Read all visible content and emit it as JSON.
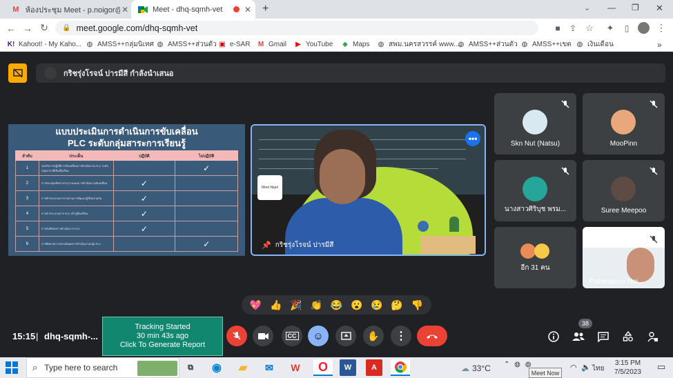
{
  "browser": {
    "tabs": [
      {
        "title": "ห้องประชุม Meet - p.noigor@gma",
        "icon": "gmail-icon"
      },
      {
        "title": "Meet - dhq-sqmh-vet",
        "icon": "meet-icon",
        "active": true
      }
    ],
    "new_tab": "+",
    "url": "meet.google.com/dhq-sqmh-vet",
    "bookmarks": [
      "Kahoot! - My Kaho...",
      "AMSS++กลุ่มนิเทศ",
      "AMSS++ส่วนตัว",
      "e-SAR",
      "Gmail",
      "YouTube",
      "Maps",
      "สพม.นครสวรรค์ www....",
      "AMSS++ส่วนตัว",
      "AMSS++เขต",
      "เงินเดือน"
    ]
  },
  "meet": {
    "presenter_text": "กริชรุ่งโรจน์ ปารมีสี กำลังนำเสนอ",
    "slide": {
      "title_line1": "แบบประเมินการดำเนินการขับเคลื่อน",
      "title_line2": "PLC ระดับกลุ่มสาระการเรียนรู้",
      "headers": [
        "ลำดับ",
        "ประเด็น",
        "ปฏิบัติ",
        "ไม่ปฏิบัติ"
      ],
      "rows": [
        {
          "num": "1",
          "text": "รองรับการปฏิบัติการขับเคลื่อนการดำเนินงาน PLC ระดับกลุ่มสาระที่เป็นชั้นเรียน",
          "done": false,
          "not_done": true
        },
        {
          "num": "2",
          "text": "การประชุมเชิงทางร่วมวางแผนการดำเนินงานขับเคลื่อน",
          "done": true,
          "not_done": false
        },
        {
          "num": "3",
          "text": "การทำกระบวนการรายงานการพัฒนาผู้เรียนร่วมกัน",
          "done": true,
          "not_done": false
        },
        {
          "num": "4",
          "text": "การนำกระบวนการ PLC เข้าสู่ห้องเรียน",
          "done": true,
          "not_done": false
        },
        {
          "num": "5",
          "text": "การบันทึกผลการดำเนินการ PLC",
          "done": true,
          "not_done": false
        },
        {
          "num": "6",
          "text": "การติดตามการประเมินผลการดำเนินงานกลุ่ม PLC",
          "done": false,
          "not_done": true
        }
      ],
      "check_mark": "✓"
    },
    "speaker_name": "กริชรุ่งโรจน์ ปารมีสี",
    "speaker_logo_text": "Meet Nigel",
    "more_options": "•••",
    "participants": [
      {
        "name": "Skn Nut (Natsu)",
        "avatar_color": "#d9e9f2"
      },
      {
        "name": "MooPinn",
        "avatar_color": "#e8a87c"
      },
      {
        "name": "นางสาวศิริบุช พรม...",
        "avatar_color": "#26a69a"
      },
      {
        "name": "Suree Meepoo",
        "avatar_color": "#5d4b44"
      },
      {
        "name": "อีก 31 คน",
        "avatar_color": "#ea8c58"
      },
      {
        "name": "Pattaraporn Noi...",
        "avatar_color": "#c8d8e0"
      }
    ],
    "reactions": [
      "💖",
      "👍",
      "🎉",
      "👏",
      "😂",
      "😮",
      "😢",
      "🤔",
      "👎"
    ],
    "clock": "15:15",
    "meeting_code": "dhq-sqmh-...",
    "tracking": {
      "line1": "Tracking Started",
      "line2": "30 min 43s ago",
      "line3": "Click To Generate Report"
    },
    "participant_count": "38",
    "colors": {
      "accent": "#8ab4f8",
      "end_call": "#ea4335",
      "tracking_bg": "#12876f"
    }
  },
  "taskbar": {
    "search_placeholder": "Type here to search",
    "weather": "33°C",
    "lang": "ไทย",
    "time": "3:15 PM",
    "date": "7/5/2023",
    "tooltip": "Meet Now"
  }
}
